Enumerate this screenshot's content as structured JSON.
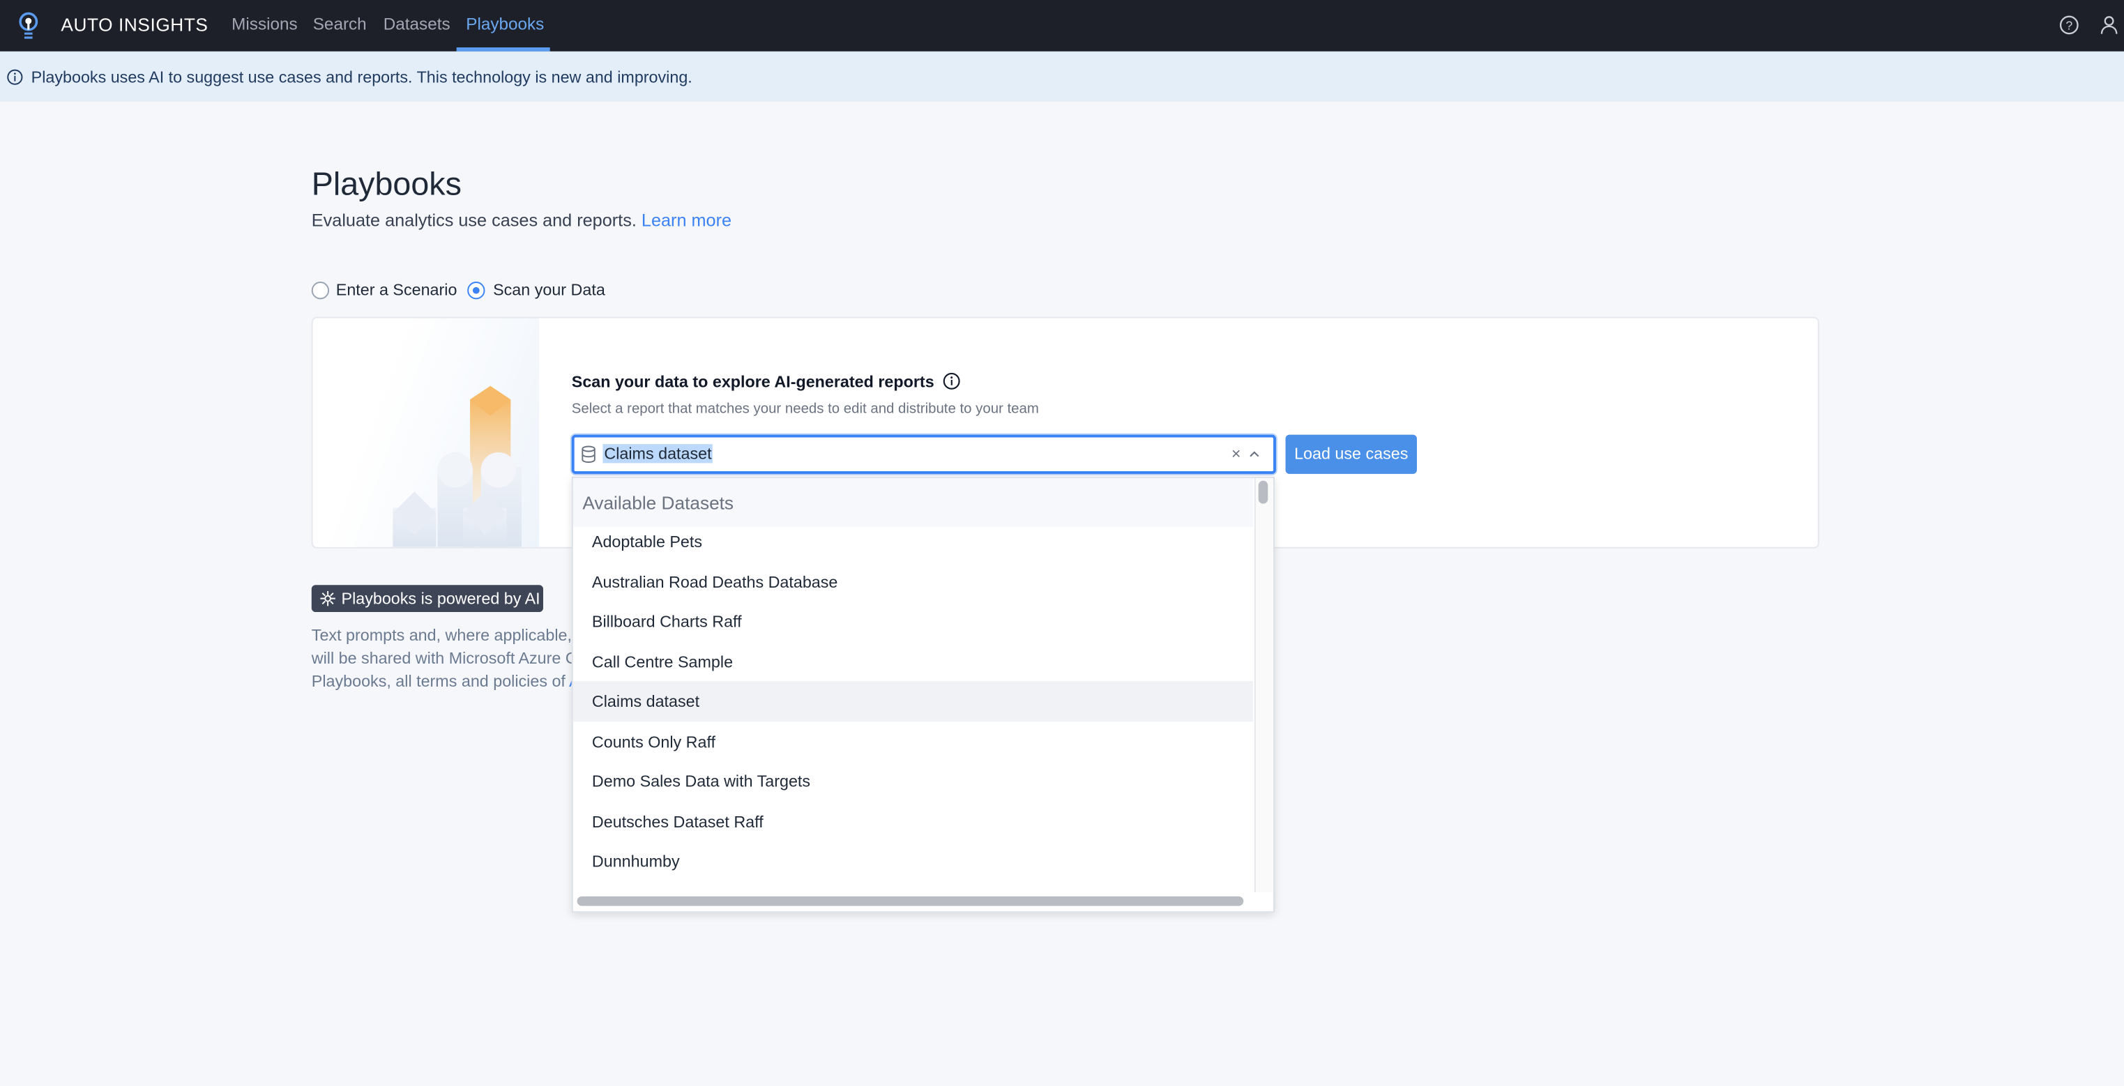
{
  "nav": {
    "brand": "AUTO INSIGHTS",
    "items": [
      {
        "label": "Missions"
      },
      {
        "label": "Search"
      },
      {
        "label": "Datasets"
      },
      {
        "label": "Playbooks",
        "active": true
      }
    ]
  },
  "banner": {
    "text": "Playbooks uses AI to suggest use cases and reports. This technology is new and improving."
  },
  "page": {
    "title": "Playbooks",
    "subtitle": "Evaluate analytics use cases and reports.",
    "learn_more": "Learn more"
  },
  "modes": {
    "options": [
      "Enter a Scenario",
      "Scan your Data"
    ],
    "selected": "Scan your Data"
  },
  "scan": {
    "heading": "Scan your data to explore AI-generated reports",
    "hint": "Select a report that matches your needs to edit and distribute to your team",
    "input_value": "Claims dataset",
    "load_button": "Load use cases"
  },
  "dropdown": {
    "header": "Available Datasets",
    "items": [
      "Adoptable Pets",
      "Australian Road Deaths Database",
      "Billboard Charts Raff",
      "Call Centre Sample",
      "Claims dataset",
      "Counts Only Raff",
      "Demo Sales Data with Targets",
      "Deutsches Dataset Raff",
      "Dunnhumby"
    ],
    "highlighted": "Claims dataset"
  },
  "ai": {
    "badge": "Playbooks is powered by AI",
    "lines": [
      "Text prompts and, where applicable, t",
      "will be shared with Microsoft Azure O",
      "Playbooks, all terms and policies of "
    ],
    "link_fragment": "A"
  },
  "colors": {
    "accent": "#3b82f6",
    "nav_bg": "#1e2029",
    "banner_bg": "#e4eef9"
  }
}
